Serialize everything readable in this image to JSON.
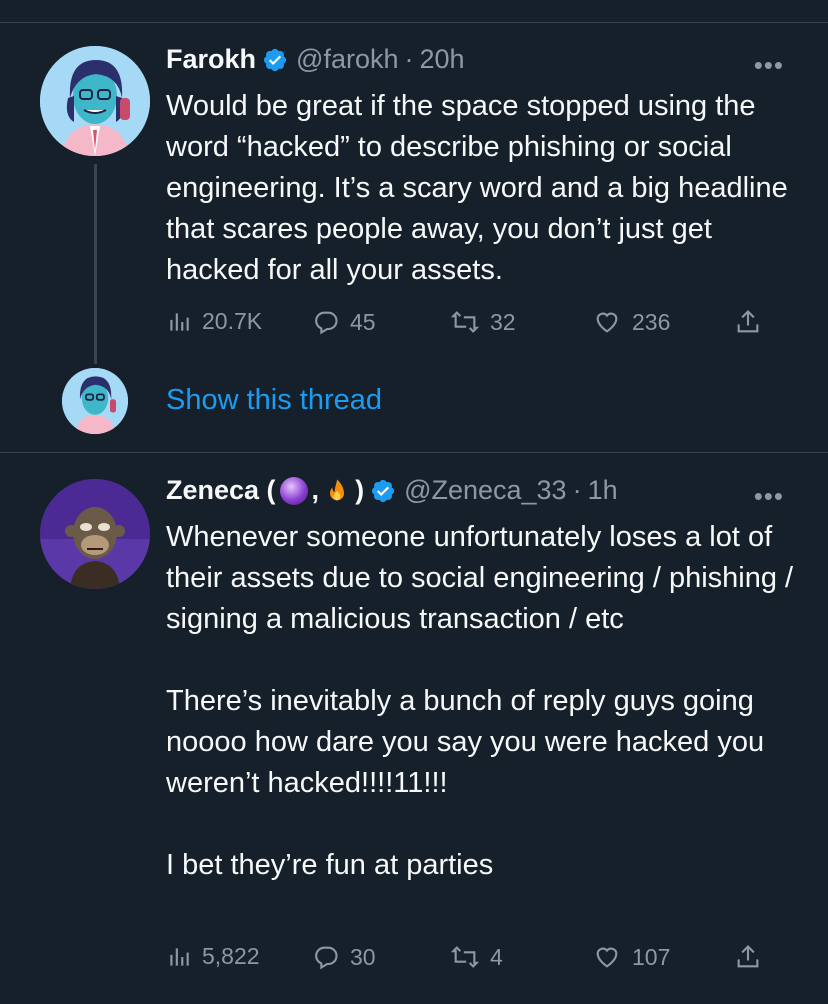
{
  "top_divider": true,
  "tweets": [
    {
      "name": "Farokh",
      "handle": "@farokh",
      "dot": "·",
      "time": "20h",
      "body": "Would be great if the space stopped using the word “hacked” to describe phishing or social engineering. It’s a scary word and a big headline that scares people away, you don’t just get hacked for all your assets.",
      "views": "20.7K",
      "replies": "45",
      "retweets": "32",
      "likes": "236"
    },
    {
      "name_prefix": "Zeneca (",
      "name_sep": ",",
      "name_suffix": ")",
      "handle": "@Zeneca_33",
      "dot": "·",
      "time": "1h",
      "body": "Whenever someone unfortunately loses a lot of their assets due to social engineering / phishing / signing a malicious transaction / etc\n\nThere’s inevitably a bunch of reply guys going noooo how dare you say you were hacked you weren’t hacked!!!!11!!!\n\nI bet they’re fun at parties",
      "views": "5,822",
      "replies": "30",
      "retweets": "4",
      "likes": "107"
    }
  ],
  "show_thread": "Show this thread",
  "more_label": "•••",
  "colors": {
    "background": "#15202b",
    "divider": "#38444d",
    "muted": "#8b98a5",
    "accent": "#1d9bf0"
  },
  "icons": [
    "verified-badge-icon",
    "views-icon",
    "reply-icon",
    "retweet-icon",
    "like-icon",
    "share-icon",
    "crystal-ball-emoji",
    "fire-emoji"
  ]
}
